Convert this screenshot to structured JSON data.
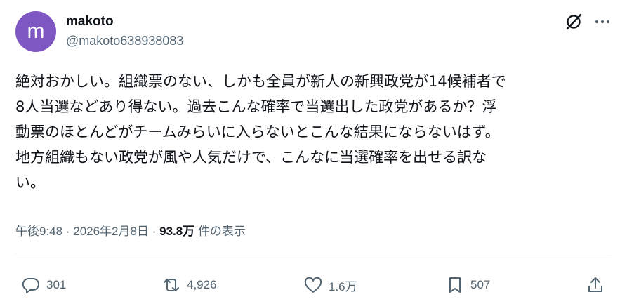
{
  "author": {
    "avatar_letter": "m",
    "avatar_color": "#7e57c2",
    "name": "makoto",
    "handle": "@makoto638938083"
  },
  "header_icons": [
    "grok-icon",
    "more-icon"
  ],
  "tweet": {
    "text": "絶対おかしい。組織票のない、しかも全員が新人の新興政党が14候補者で\n8人当選などあり得ない。過去こんな確率で当選出した政党があるか？浮\n動票のほとんどがチームみらいに入らないとこんな結果にならないはず。\n地方組織もない政党が風や人気だけで、こんなに当選確率を出せる訳な\nい。"
  },
  "meta": {
    "time": "午後9:48",
    "separator": "·",
    "date": "2026年2月8日",
    "views": "93.8万",
    "views_label": "件の表示"
  },
  "actions": {
    "replies": "301",
    "reposts": "4,926",
    "likes": "1.6万",
    "bookmarks": "507"
  },
  "colors": {
    "text": "#0f1419",
    "secondary": "#536471"
  }
}
